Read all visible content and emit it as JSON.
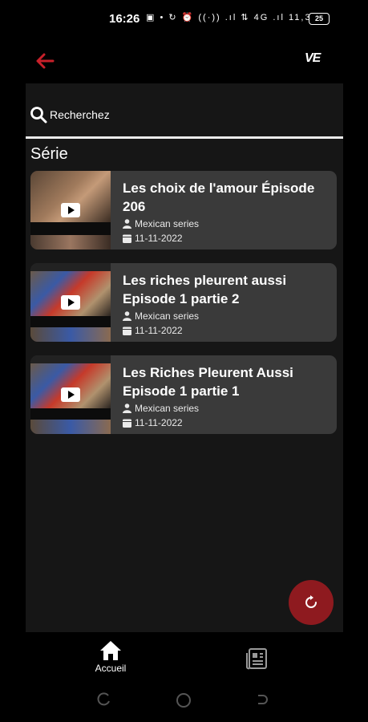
{
  "status_bar": {
    "time": "16:26",
    "indicators": "▣ • ↻ ⏰ ((·)) .ıl ⇅ 4G .ıl 11,3",
    "battery": "25"
  },
  "app_bar": {
    "logo": "VE"
  },
  "search": {
    "placeholder": "Recherchez"
  },
  "section_title": "Série",
  "items": [
    {
      "title": "Les choix de l'amour Épisode 206",
      "category": "Mexican series",
      "date": "11-11-2022"
    },
    {
      "title": "Les riches pleurent aussi Episode 1 partie 2",
      "category": "Mexican series",
      "date": "11-11-2022"
    },
    {
      "title": "Les Riches Pleurent Aussi Episode 1 partie 1",
      "category": "Mexican series",
      "date": "11-11-2022"
    }
  ],
  "bottom_nav": {
    "home_label": "Accueil"
  },
  "colors": {
    "accent": "#8e1a1f",
    "back_arrow": "#c8202a",
    "card": "#3a3a3a",
    "panel": "#161616"
  },
  "icons": [
    "back-arrow-icon",
    "search-icon",
    "play-icon",
    "person-icon",
    "calendar-icon",
    "refresh-icon",
    "home-icon",
    "news-icon"
  ]
}
